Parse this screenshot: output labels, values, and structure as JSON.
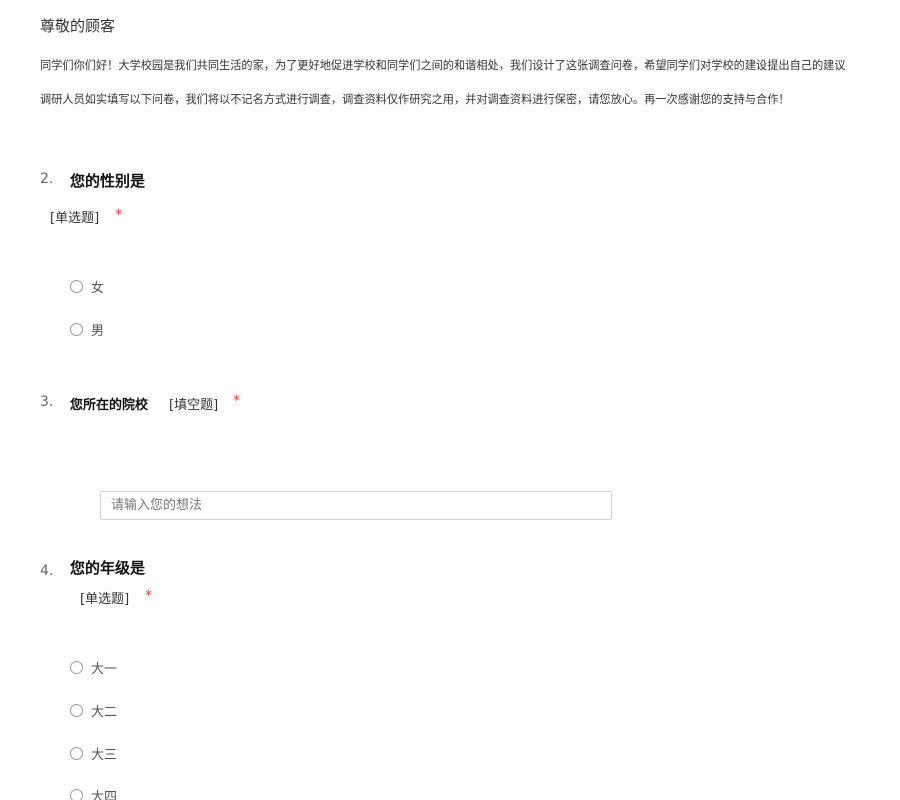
{
  "header": {
    "greeting": "尊敬的顾客",
    "intro_line1": "同学们你们好！大学校园是我们共同生活的家，为了更好地促进学校和同学们之间的和谐相处，我们设计了这张调查问卷，希望同学们对学校的建设提出自己的建议",
    "intro_line2": "调研人员如实填写以下问卷，我们将以不记名方式进行调查，调查资料仅作研究之用，并对调查资料进行保密，请您放心。再一次感谢您的支持与合作！"
  },
  "questions": [
    {
      "number": "2.",
      "title": "您的性别是",
      "type": "[单选题]",
      "required": "*",
      "options": [
        "女",
        "男"
      ]
    },
    {
      "number": "3.",
      "title": "您所在的院校",
      "type": "[填空题]",
      "required": "*",
      "placeholder": "请输入您的想法"
    },
    {
      "number": "4.",
      "title": "您的年级是",
      "type": "[单选题]",
      "required": "*",
      "options": [
        "大一",
        "大二",
        "大三",
        "大四"
      ]
    }
  ]
}
